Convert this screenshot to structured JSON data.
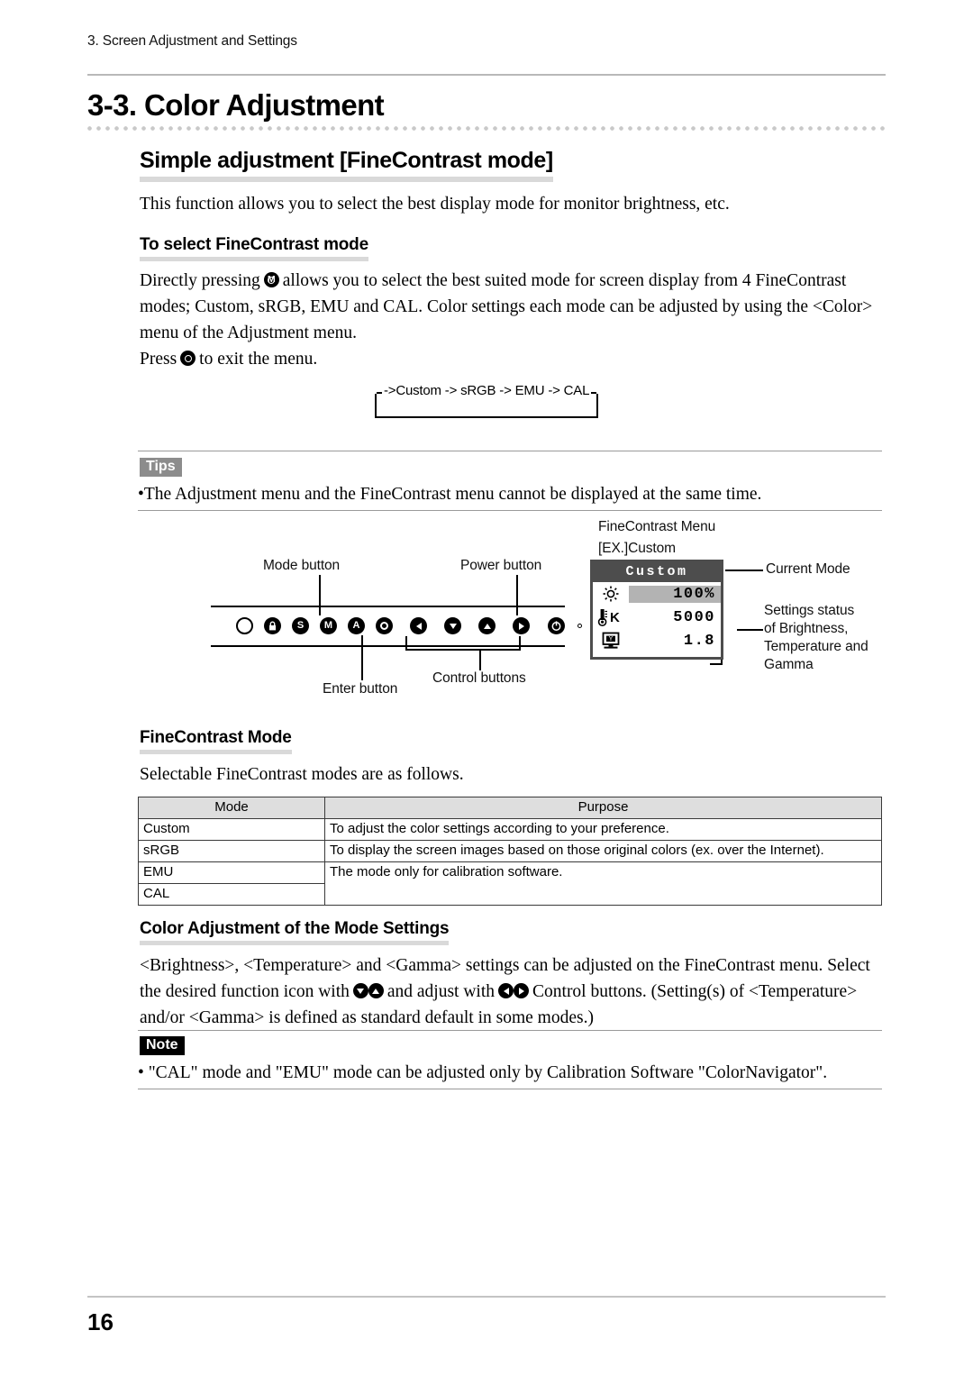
{
  "header": {
    "running_head": "3. Screen Adjustment and Settings"
  },
  "chapter": {
    "title": "3-3. Color Adjustment"
  },
  "section": {
    "heading": "Simple adjustment [FineContrast mode]",
    "intro": "This function allows you to select the best display mode for monitor brightness, etc."
  },
  "select_mode": {
    "heading": "To select FineContrast mode",
    "para_1a": "Directly pressing",
    "para_1b": "allows you to select the best suited mode for screen display from 4 FineContrast",
    "para_2": "modes; Custom, sRGB, EMU and CAL. Color settings each mode can be adjusted by using the <Color>",
    "para_3": "menu of the Adjustment menu.",
    "para_4a": "Press",
    "para_4b": "to exit the menu.",
    "mode_icon": "M",
    "enter_icon": "enter-icon",
    "loop_label": "->Custom -> sRGB -> EMU -> CAL"
  },
  "tips": {
    "badge": "Tips",
    "bullet": "•The Adjustment menu and the FineContrast menu cannot be displayed at the same time."
  },
  "diagram": {
    "mode_button_label": "Mode button",
    "power_button_label": "Power button",
    "enter_button_label": "Enter button",
    "control_buttons_label": "Control buttons",
    "finecontrast_menu_label": "FineContrast Menu",
    "example_label": "[EX.]Custom",
    "current_mode_label": "Current Mode",
    "settings_status_line1": "Settings status",
    "settings_status_line2": "of Brightness,",
    "settings_status_line3": "Temperature and",
    "settings_status_line4": "Gamma",
    "buttons": [
      {
        "name": "indicator-hollow",
        "glyph": ""
      },
      {
        "name": "lock-button",
        "glyph": "◮"
      },
      {
        "name": "signal-button",
        "glyph": "S"
      },
      {
        "name": "mode-button",
        "glyph": "M"
      },
      {
        "name": "auto-button",
        "glyph": "A"
      },
      {
        "name": "enter-button",
        "glyph": ""
      },
      {
        "name": "left-button",
        "glyph": "◀"
      },
      {
        "name": "down-button",
        "glyph": "▼"
      },
      {
        "name": "up-button",
        "glyph": "▲"
      },
      {
        "name": "right-button",
        "glyph": "▶"
      },
      {
        "name": "power-button",
        "glyph": "⏻"
      }
    ]
  },
  "osd": {
    "title": "Custom",
    "brightness_value": "100%",
    "temperature_value": "5000",
    "gamma_value": "1.8",
    "temperature_unit": "K",
    "frame_color": "#4d4d4d",
    "highlight_color": "#b3b3b3"
  },
  "fc_mode": {
    "heading": "FineContrast Mode",
    "intro": "Selectable FineContrast modes are as follows.",
    "table": {
      "columns": [
        "Mode",
        "Purpose"
      ],
      "rows": [
        {
          "mode": "Custom",
          "purpose": "To adjust the color settings according to your preference."
        },
        {
          "mode": "sRGB",
          "purpose": "To display the screen images based on those original colors (ex. over the Internet)."
        },
        {
          "mode": "EMU",
          "purpose": "The mode only for calibration software."
        },
        {
          "mode": "CAL",
          "purpose": ""
        }
      ]
    }
  },
  "color_adjust": {
    "heading": "Color Adjustment of the Mode Settings",
    "line1a": "<Brightness>, <Temperature> and <Gamma> settings can be adjusted on the FineContrast menu. Select",
    "line2a": "the desired function icon with",
    "line2b": "and adjust with",
    "line2c": "Control buttons. (Setting(s) of <Temperature>",
    "line3": "and/or <Gamma> is defined as standard default in some modes.)"
  },
  "note": {
    "badge": "Note",
    "bullet": "• \"CAL\" mode and \"EMU\" mode can be adjusted only by Calibration Software \"ColorNavigator\"."
  },
  "footer": {
    "page_number": "16"
  }
}
